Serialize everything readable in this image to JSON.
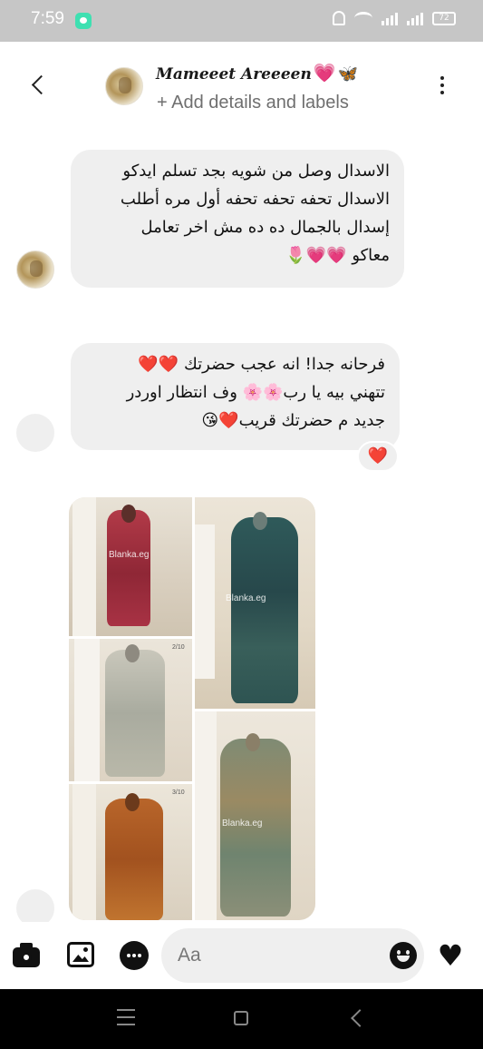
{
  "status_bar": {
    "time": "7:59",
    "battery": "72",
    "icons": [
      "notification-app-icon",
      "mute-bell-icon",
      "wifi-icon",
      "signal-icon",
      "signal-icon",
      "battery-icon"
    ]
  },
  "header": {
    "contact_name": "Mameeet Areeeen",
    "name_emojis": [
      "💗",
      "🦋"
    ],
    "subtitle": "+ Add details and labels",
    "icons": [
      "back-icon",
      "more-vertical-icon"
    ]
  },
  "messages": [
    {
      "sender": "contact",
      "lines": [
        "الاسدال وصل من شويه بجد تسلم ايدكو",
        "الاسدال تحفه تحفه تحفه أول مره أطلب",
        "إسدال بالجمال ده ده مش اخر تعامل",
        "معاكو 💗💗🌷"
      ]
    },
    {
      "sender": "contact",
      "lines": [
        "فرحانه جدا! انه عجب حضرتك ❤️❤️",
        "تتهني بيه يا رب🌸🌸 وف انتظار اوردر",
        "جديد م حضرتك قريب❤️😘"
      ],
      "reaction": "❤️"
    },
    {
      "sender": "contact",
      "type": "image-collage",
      "watermark": "Blanka.eg",
      "page_labels": [
        "2/10",
        "3/10"
      ],
      "photo_colors": [
        "#b23a48",
        "#2f5a5a",
        "#b9b8a9",
        "#b8652a",
        "#7f8b74"
      ]
    }
  ],
  "composer": {
    "placeholder": "Aa",
    "icons": [
      "camera-icon",
      "gallery-icon",
      "chat-bubble-icon",
      "emoji-icon",
      "heart-icon"
    ]
  },
  "nav_bar": {
    "icons": [
      "recents-icon",
      "home-icon",
      "back-triangle-icon"
    ]
  }
}
